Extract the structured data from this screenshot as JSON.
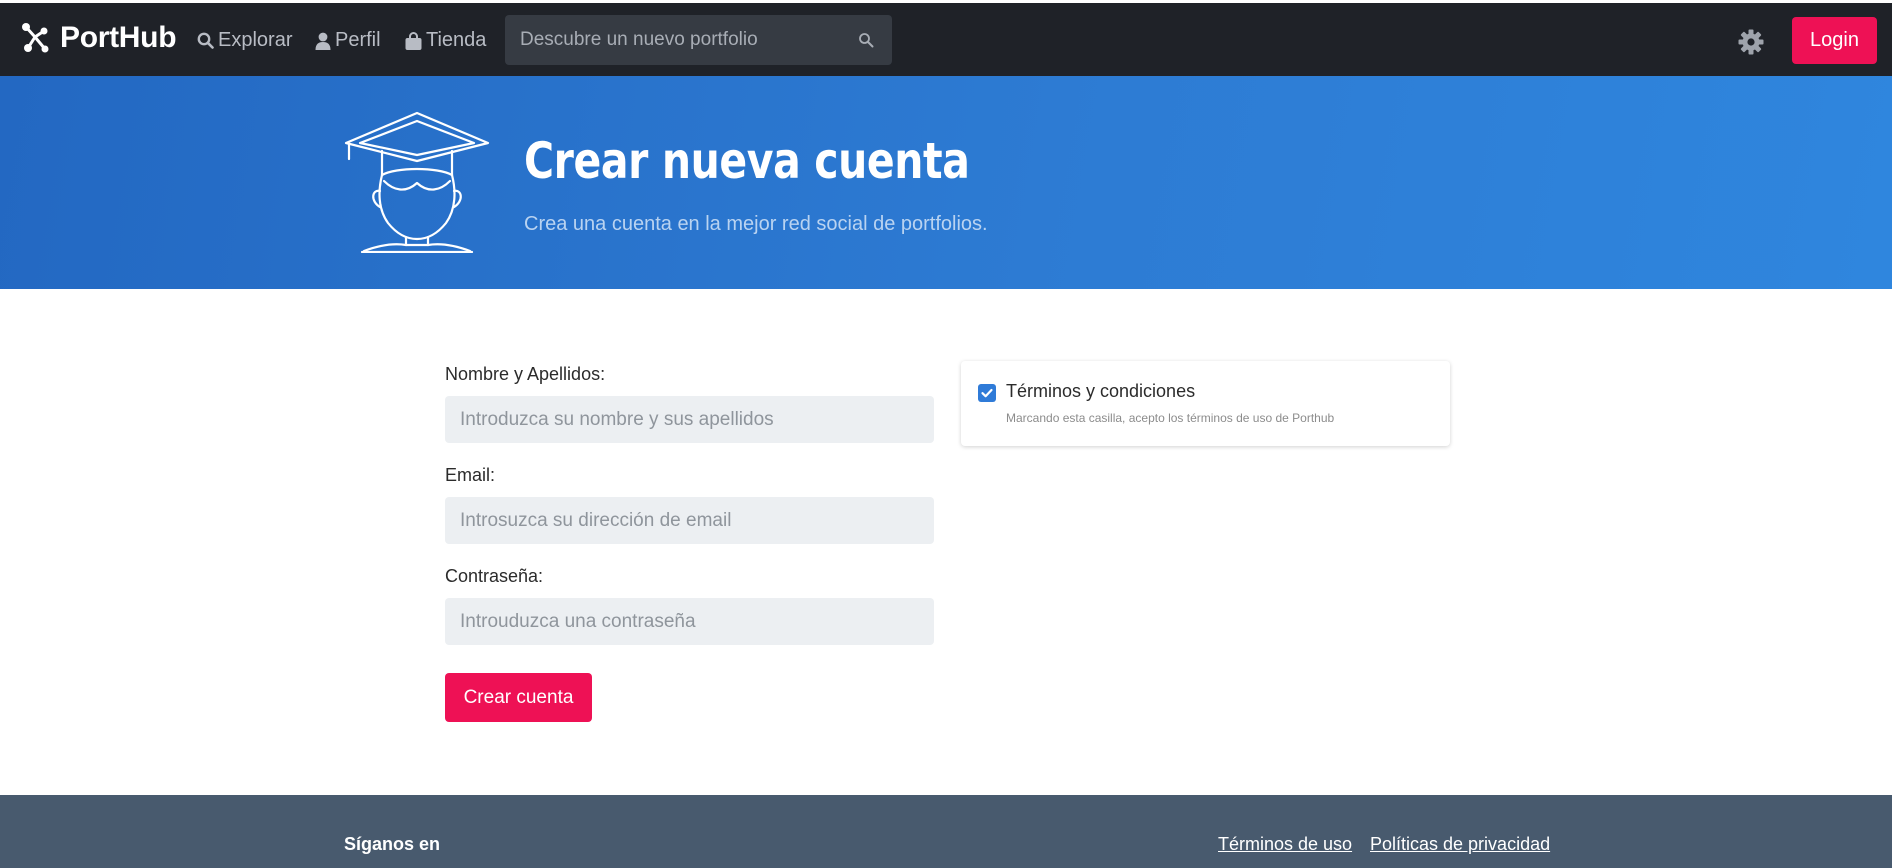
{
  "navbar": {
    "brand": "PortHub",
    "items": [
      {
        "label": "Explorar",
        "icon": "search-icon"
      },
      {
        "label": "Perfil",
        "icon": "user-icon"
      },
      {
        "label": "Tienda",
        "icon": "shopping-bag-icon"
      }
    ],
    "search": {
      "placeholder": "Descubre un nuevo portfolio",
      "value": ""
    },
    "settings_icon": "gear-icon",
    "login_label": "Login"
  },
  "hero": {
    "icon": "graduate-icon",
    "title": "Crear nueva cuenta",
    "subtitle": "Crea una cuenta en la mejor red social de portfolios."
  },
  "form": {
    "fields": [
      {
        "label": "Nombre y Apellidos:",
        "placeholder": "Introduzca su nombre y sus apellidos",
        "value": ""
      },
      {
        "label": "Email:",
        "placeholder": "Introsuzca su dirección de email",
        "value": ""
      },
      {
        "label": "Contraseña:",
        "placeholder": "Introuduzca una contraseña",
        "value": ""
      }
    ],
    "submit_label": "Crear cuenta"
  },
  "terms": {
    "checked": true,
    "title": "Términos y condiciones",
    "description": "Marcando esta casilla, acepto los términos de uso de Porthub"
  },
  "footer": {
    "follow_label": "Síganos en",
    "links": [
      {
        "label": "Términos de uso"
      },
      {
        "label": "Políticas de privacidad"
      }
    ]
  },
  "colors": {
    "navbar_bg": "#1f2228",
    "accent": "#ee1155",
    "hero_blue": "#2d7bd3",
    "footer_bg": "#485a6e"
  }
}
